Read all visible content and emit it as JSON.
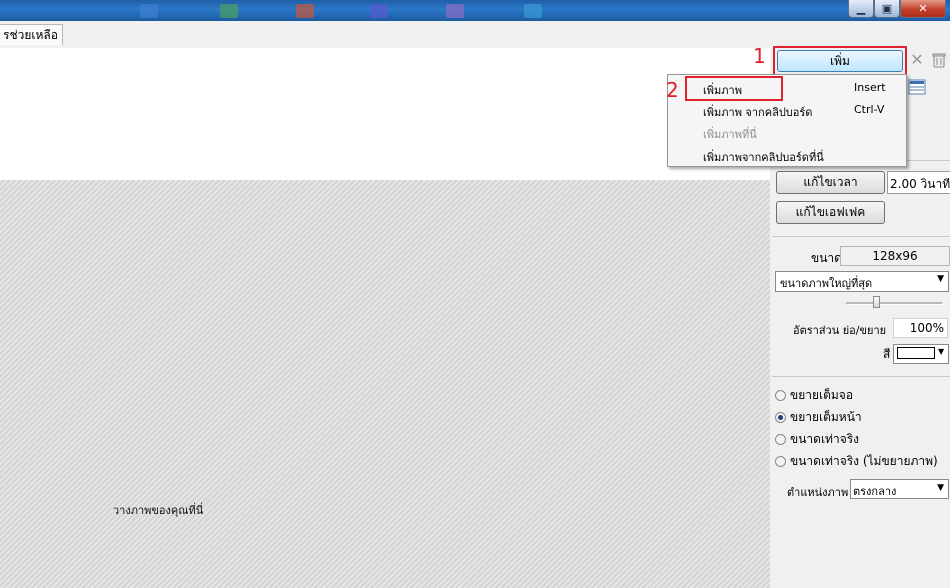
{
  "window": {
    "buttons": {
      "minimize": "▁",
      "maximize": "▣",
      "close": "✕"
    }
  },
  "tabs": [
    {
      "label": "รช่วยเหลือ"
    }
  ],
  "toolbar": {
    "add_label": "เพิ่ม",
    "icons": [
      "delete-icon",
      "trash-icon",
      "list-icon"
    ]
  },
  "annotations": {
    "marker1": "1",
    "marker2": "2",
    "highlight_color": "#e0202a"
  },
  "context_menu": {
    "items": [
      {
        "label": "เพิ่มภาพ",
        "shortcut": "Insert",
        "enabled": true
      },
      {
        "label": "เพิ่มภาพ จากคลิปบอร์ด",
        "shortcut": "Ctrl-V",
        "enabled": true
      },
      {
        "label": "เพิ่มภาพที่นี่",
        "shortcut": "",
        "enabled": false
      },
      {
        "label": "เพิ่มภาพจากคลิปบอร์ดที่นี่",
        "shortcut": "",
        "enabled": true
      }
    ]
  },
  "canvas": {
    "placeholder": "วางภาพของคุณที่นี่"
  },
  "panel": {
    "edit_time_label": "แก้ไขเวลา",
    "time_value": "2.00 วินาที",
    "edit_effect_label": "แก้ไขเอฟเฟค",
    "size_label": "ขนาด",
    "size_value": "128x96",
    "size_mode": "ขนาดภาพใหญ่ที่สุด",
    "ratio_label": "อัตราส่วน ย่อ/ขยาย",
    "ratio_value": "100%",
    "color_label": "สี",
    "fit_options": [
      {
        "label": "ขยายเต็มจอ",
        "selected": false
      },
      {
        "label": "ขยายเต็มหน้า",
        "selected": true
      },
      {
        "label": "ขนาดเท่าจริง",
        "selected": false
      },
      {
        "label": "ขนาดเท่าจริง (ไม่ขยายภาพ)",
        "selected": false
      }
    ],
    "position_label": "ตำแหน่งภาพ",
    "position_value": "ตรงกลาง"
  }
}
